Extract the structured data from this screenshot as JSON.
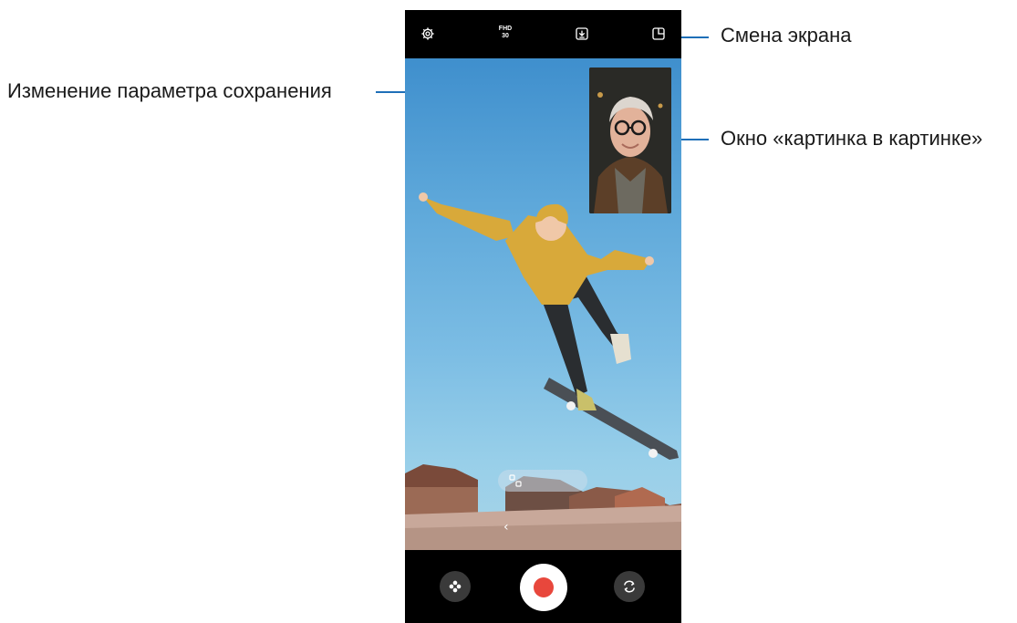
{
  "callouts": {
    "save_option": "Изменение параметра сохранения",
    "switch_screen": "Смена экрана",
    "pip_window": "Окно «картинка в картинке»"
  },
  "topbar": {
    "resolution": "FHD",
    "fps": "30"
  },
  "icons": {
    "settings": "gear-icon",
    "save_option": "download-icon",
    "switch_screen": "layout-icon",
    "effects": "flower-icon",
    "record": "record-dot",
    "flip": "camera-flip-icon",
    "back": "chevron-left-icon"
  },
  "viewfinder": {
    "back_chevron": "‹"
  },
  "colors": {
    "callout_line": "#1e6fb8",
    "record_red": "#e8473c",
    "sky_blue": "#5ea8da"
  }
}
